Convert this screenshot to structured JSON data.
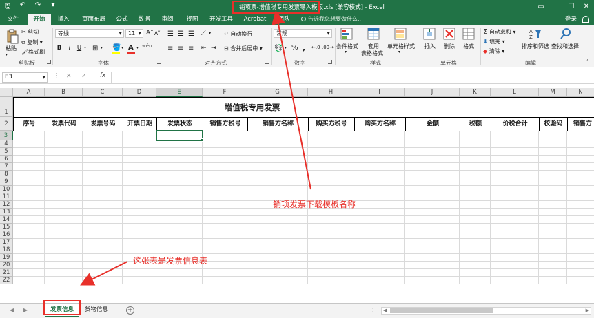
{
  "title_bar": {
    "title": "销项票-增值税专用发票导入模板.xls [兼容模式] - Excel",
    "qat_icons": [
      "save-icon",
      "undo-icon",
      "redo-icon",
      "customize-qat-icon"
    ]
  },
  "tabs": {
    "items": [
      "文件",
      "开始",
      "插入",
      "页面布局",
      "公式",
      "数据",
      "审阅",
      "视图",
      "开发工具",
      "Acrobat",
      "团队"
    ],
    "active": "开始",
    "tell_me": "告诉我您想要做什么...",
    "login": "登录"
  },
  "ribbon": {
    "clipboard": {
      "paste": "粘贴",
      "cut": "剪切",
      "copy": "复制",
      "format_painter": "格式刷",
      "label": "剪贴板"
    },
    "font": {
      "name": "等线",
      "size": "11",
      "bold": "B",
      "italic": "I",
      "underline": "U",
      "grow": "A",
      "shrink": "A",
      "wen": "wén",
      "label": "字体"
    },
    "alignment": {
      "wrap": "自动换行",
      "merge": "合并后居中",
      "label": "对齐方式"
    },
    "number": {
      "format": "常规",
      "percent": "%",
      "comma": ",",
      "label": "数字"
    },
    "styles": {
      "conditional": "条件格式",
      "table_line1": "套用",
      "table_line2": "表格格式",
      "cell_styles": "单元格样式",
      "label": "样式"
    },
    "cells": {
      "insert": "插入",
      "delete": "删除",
      "format": "格式",
      "label": "单元格"
    },
    "editing": {
      "autosum": "自动求和",
      "fill": "填充",
      "clear": "清除",
      "sort": "排序和筛选",
      "find": "查找和选择",
      "label": "编辑"
    }
  },
  "formula_bar": {
    "cell_ref": "E3",
    "fx": "fx",
    "value": ""
  },
  "sheet": {
    "columns": [
      "A",
      "B",
      "C",
      "D",
      "E",
      "F",
      "G",
      "H",
      "I",
      "J",
      "K",
      "L",
      "M",
      "N"
    ],
    "rows": [
      "1",
      "2",
      "3",
      "4",
      "5",
      "6",
      "7",
      "8",
      "9",
      "10",
      "11",
      "12",
      "13",
      "14",
      "15",
      "16",
      "17",
      "18",
      "19",
      "20",
      "21",
      "22"
    ],
    "selected_col": "E",
    "selected_row": "3",
    "title": "增值税专用发票",
    "headers": [
      "序号",
      "发票代码",
      "发票号码",
      "开票日期",
      "发票状态",
      "销售方税号",
      "销售方名称",
      "购买方税号",
      "购买方名称",
      "金额",
      "税额",
      "价税合计",
      "校验码",
      "销售方"
    ]
  },
  "sheet_tabs": {
    "items": [
      "发票信息",
      "货物信息"
    ],
    "active": "发票信息"
  },
  "annotations": {
    "template_name": "销项发票下载模板名称",
    "sheet_note": "这张表是发票信息表"
  },
  "colors": {
    "excel_green": "#217346",
    "annotation_red": "#e8302a"
  }
}
